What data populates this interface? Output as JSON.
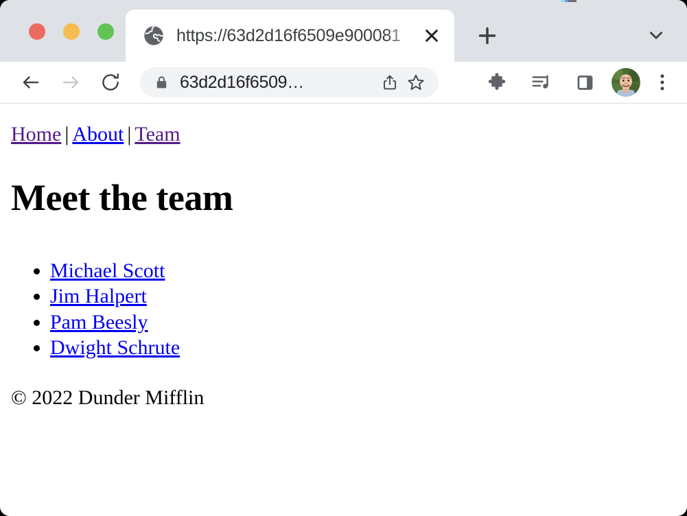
{
  "window": {
    "traffic_lights": [
      {
        "name": "close",
        "color": "#ed6a5e"
      },
      {
        "name": "minimize",
        "color": "#f5bd4f"
      },
      {
        "name": "zoom",
        "color": "#61c454"
      }
    ]
  },
  "tabstrip": {
    "tab": {
      "favicon": "globe-icon",
      "title": "https://63d2d16f6509e900081",
      "close_label": "✕"
    },
    "new_tab_label": "+",
    "tab_list_label": "⌄"
  },
  "toolbar": {
    "back": "back-arrow-icon",
    "forward": "forward-arrow-icon",
    "reload": "reload-icon",
    "omnibox": {
      "lock": "lock-icon",
      "url": "63d2d16f6509…",
      "share": "share-icon",
      "bookmark": "star-icon"
    },
    "extensions": "puzzle-icon",
    "media": "media-control-icon",
    "side_panel": "side-panel-icon",
    "profile": "avatar",
    "menu": "three-dot-menu-icon"
  },
  "page": {
    "nav": {
      "separator": "|",
      "links": [
        {
          "label": "Home",
          "state": "visited"
        },
        {
          "label": "About",
          "state": "unvisited"
        },
        {
          "label": "Team",
          "state": "visited"
        }
      ]
    },
    "heading": "Meet the team",
    "team": [
      "Michael Scott",
      "Jim Halpert",
      "Pam Beesly",
      "Dwight Schrute"
    ],
    "footer": "© 2022 Dunder Mifflin"
  },
  "colors": {
    "visited_link": "#551a8b",
    "unvisited_link": "#0000ee",
    "tabstrip_bg": "#dee1e6",
    "omnibox_bg": "#f1f3f4"
  }
}
